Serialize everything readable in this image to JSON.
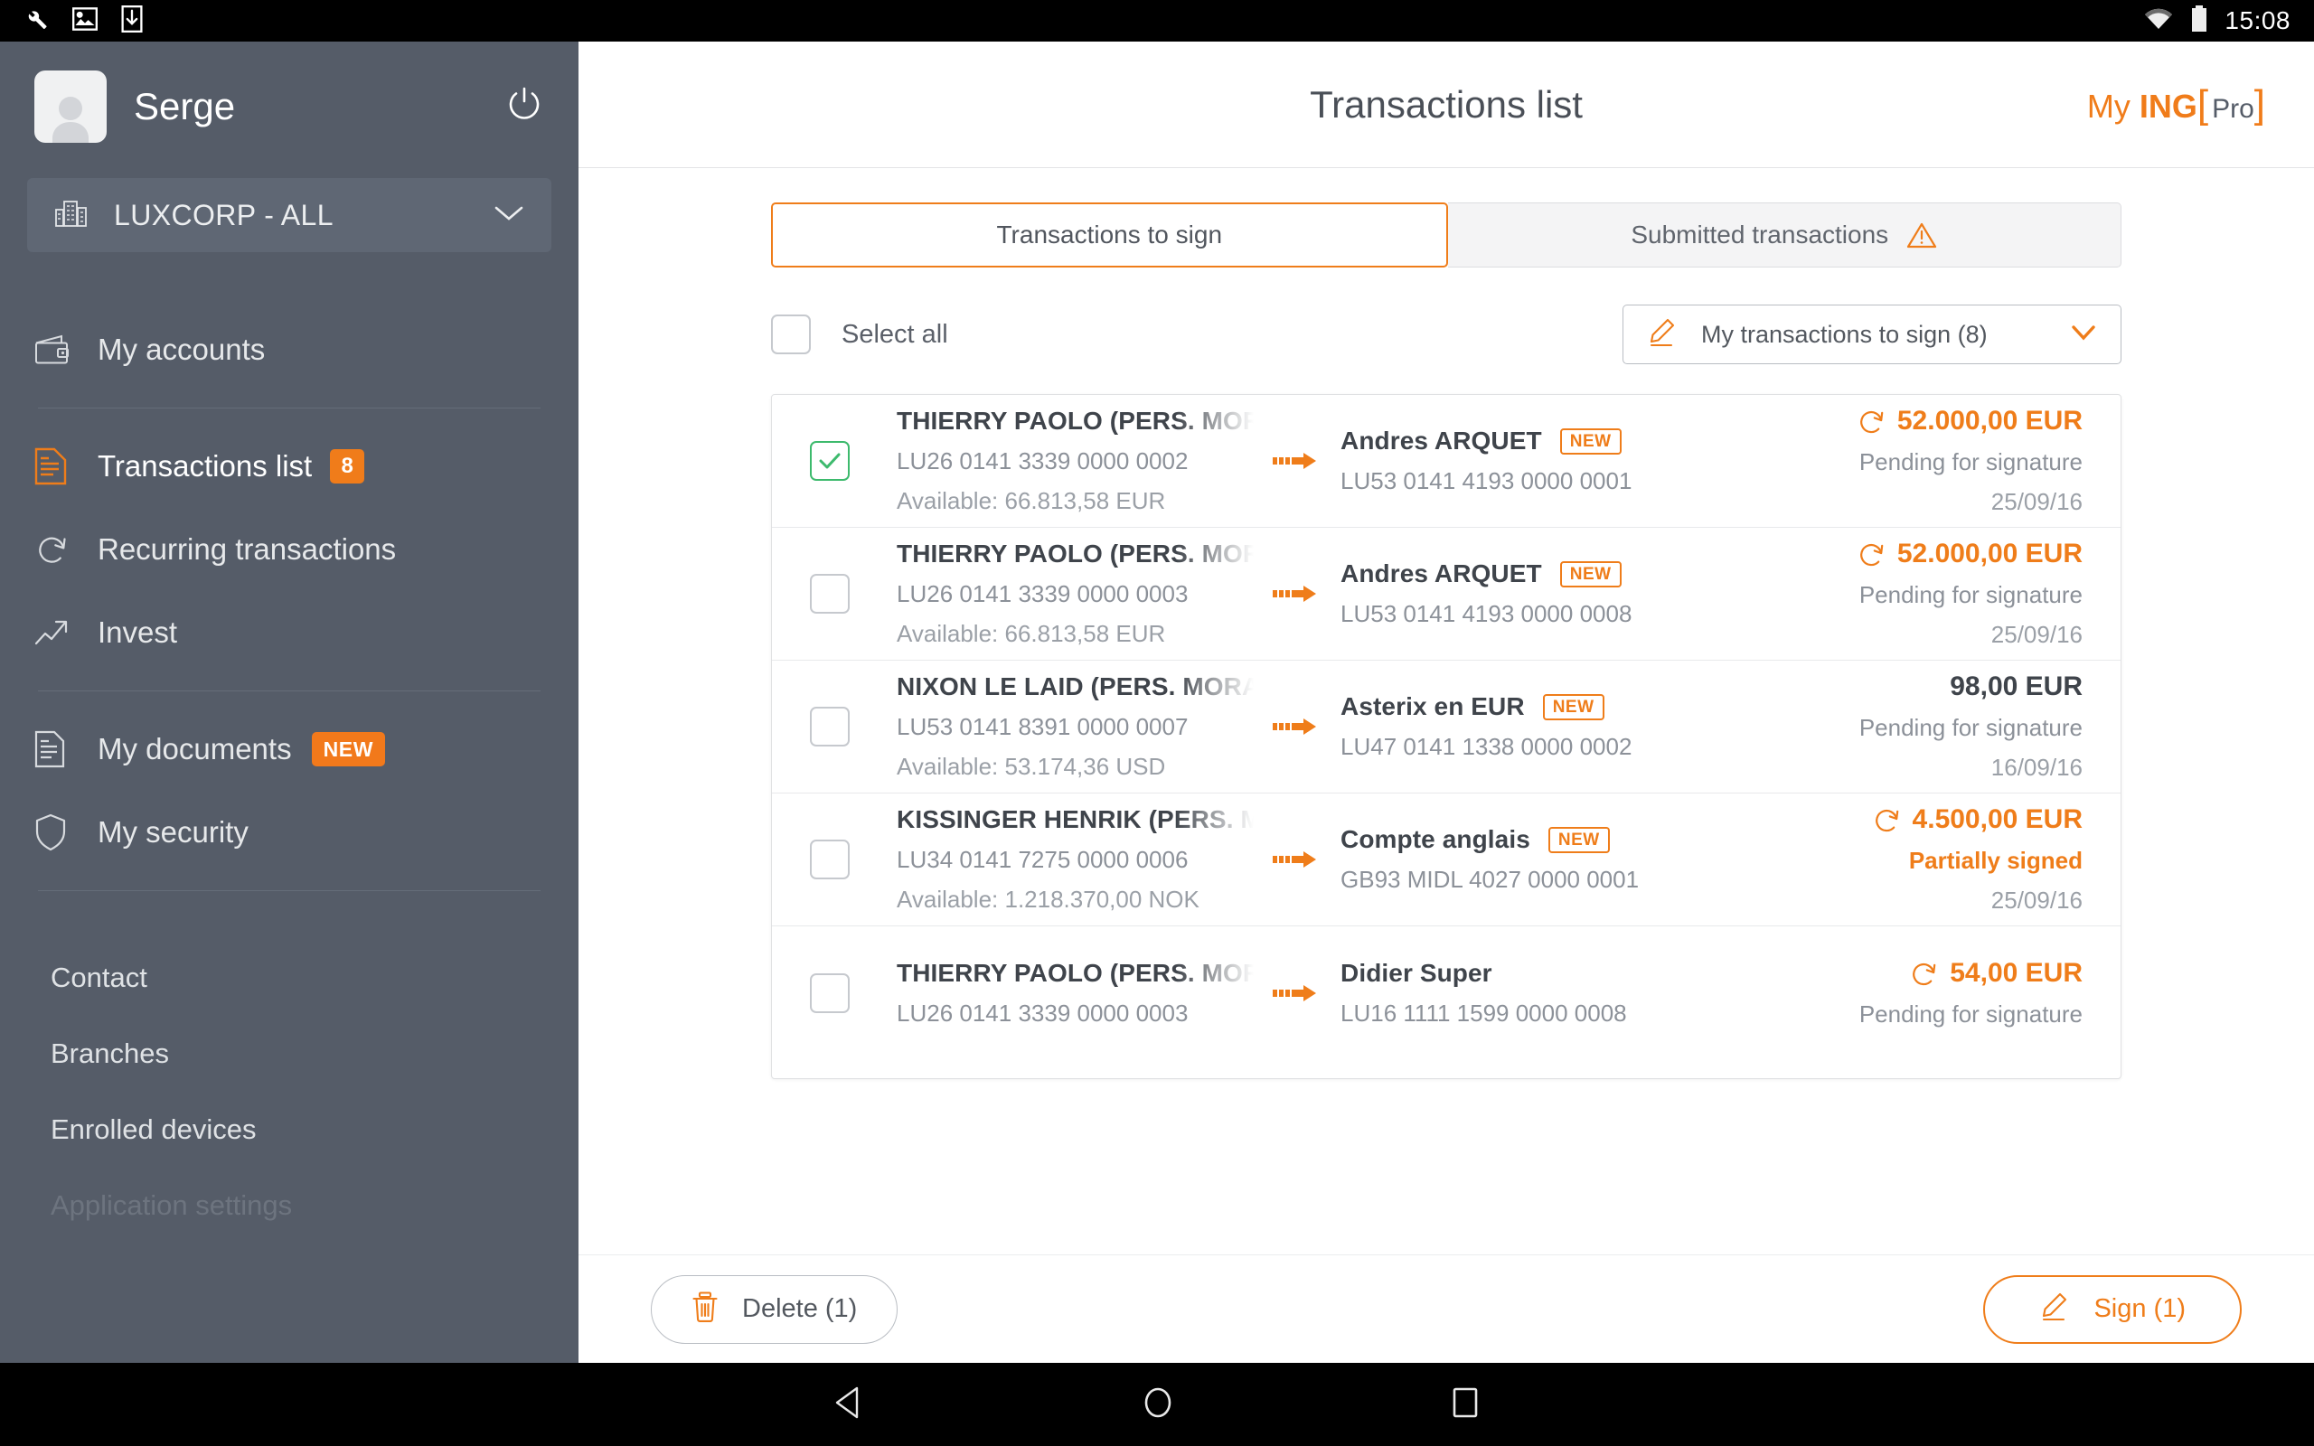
{
  "status_bar": {
    "time": "15:08",
    "icons": [
      "wrench-icon",
      "image-icon",
      "download-icon",
      "wifi-icon",
      "battery-icon"
    ]
  },
  "sidebar": {
    "user_name": "Serge",
    "power_icon": "power-icon",
    "organisation": {
      "label": "LUXCORP - ALL",
      "icon": "building-icon",
      "caret": "chevron-down-icon"
    },
    "nav": [
      {
        "label": "My accounts",
        "icon": "wallet-icon",
        "active": false
      },
      {
        "label": "Transactions list",
        "icon": "transactions-icon",
        "active": true,
        "badge": "8"
      },
      {
        "label": "Recurring transactions",
        "icon": "recurring-icon",
        "active": false
      },
      {
        "label": "Invest",
        "icon": "trend-up-icon",
        "active": false
      },
      {
        "label": "My documents",
        "icon": "document-icon",
        "active": false,
        "tag": "NEW"
      },
      {
        "label": "My security",
        "icon": "shield-icon",
        "active": false
      }
    ],
    "links": [
      {
        "label": "Contact",
        "dim": false
      },
      {
        "label": "Branches",
        "dim": false
      },
      {
        "label": "Enrolled devices",
        "dim": false
      },
      {
        "label": "Application settings",
        "dim": true
      }
    ]
  },
  "header": {
    "title": "Transactions list",
    "brand": {
      "my": "My",
      "ing": "ING",
      "bracket_open": "[",
      "pro": "Pro",
      "bracket_close": "]"
    }
  },
  "tabs": [
    {
      "label": "Transactions to sign",
      "active": true,
      "icon": null
    },
    {
      "label": "Submitted transactions",
      "active": false,
      "icon": "warning-triangle-icon"
    }
  ],
  "toolbar": {
    "select_all_label": "Select all",
    "select_all_checked": false,
    "filter": {
      "label": "My transactions to sign (8)",
      "icon": "pen-icon",
      "caret": "chevron-down-icon"
    }
  },
  "transactions": [
    {
      "checked": true,
      "from_name": "THIERRY PAOLO (PERS. MOR",
      "from_iban": "LU26 0141 3339 0000 0002",
      "from_available": "Available: 66.813,58 EUR",
      "to_name": "Andres ARQUET",
      "to_tag": "NEW",
      "to_iban": "LU53 0141 4193 0000 0001",
      "amount": "52.000,00 EUR",
      "amount_orange": true,
      "recurring": true,
      "status": "Pending for signature",
      "status_highlight": false,
      "date": "25/09/16"
    },
    {
      "checked": false,
      "from_name": "THIERRY PAOLO (PERS. MOR",
      "from_iban": "LU26 0141 3339 0000 0003",
      "from_available": "Available: 66.813,58 EUR",
      "to_name": "Andres ARQUET",
      "to_tag": "NEW",
      "to_iban": "LU53 0141 4193 0000 0008",
      "amount": "52.000,00 EUR",
      "amount_orange": true,
      "recurring": true,
      "status": "Pending for signature",
      "status_highlight": false,
      "date": "25/09/16"
    },
    {
      "checked": false,
      "from_name": "NIXON LE LAID (PERS. MORA",
      "from_iban": "LU53 0141 8391 0000 0007",
      "from_available": "Available: 53.174,36 USD",
      "to_name": "Asterix en EUR",
      "to_tag": "NEW",
      "to_iban": "LU47 0141 1338 0000 0002",
      "amount": "98,00 EUR",
      "amount_orange": false,
      "recurring": false,
      "status": "Pending for signature",
      "status_highlight": false,
      "date": "16/09/16"
    },
    {
      "checked": false,
      "from_name": "KISSINGER HENRIK (PERS. M",
      "from_iban": "LU34 0141 7275 0000 0006",
      "from_available": "Available: 1.218.370,00 NOK",
      "to_name": "Compte anglais",
      "to_tag": "NEW",
      "to_iban": "GB93 MIDL 4027 0000 0001",
      "amount": "4.500,00 EUR",
      "amount_orange": true,
      "recurring": true,
      "status": "Partially signed",
      "status_highlight": true,
      "date": "25/09/16"
    },
    {
      "checked": false,
      "from_name": "THIERRY PAOLO (PERS. MOR",
      "from_iban": "LU26 0141 3339 0000 0003",
      "from_available": "",
      "to_name": "Didier Super",
      "to_tag": "",
      "to_iban": "LU16 1111 1599 0000 0008",
      "amount": "54,00 EUR",
      "amount_orange": true,
      "recurring": true,
      "status": "Pending for signature",
      "status_highlight": false,
      "date": ""
    }
  ],
  "actions": {
    "delete": {
      "label": "Delete (1)",
      "icon": "trash-icon"
    },
    "sign": {
      "label": "Sign (1)",
      "icon": "pen-icon"
    }
  },
  "android_nav": {
    "back": "back-triangle-icon",
    "home": "home-circle-icon",
    "recents": "recents-square-icon"
  },
  "colors": {
    "accent": "#ef7d1a",
    "sidebar_bg": "#555c68",
    "text_dark": "#3f444b",
    "text_muted": "#8c9199",
    "check_green": "#3dba6d"
  }
}
